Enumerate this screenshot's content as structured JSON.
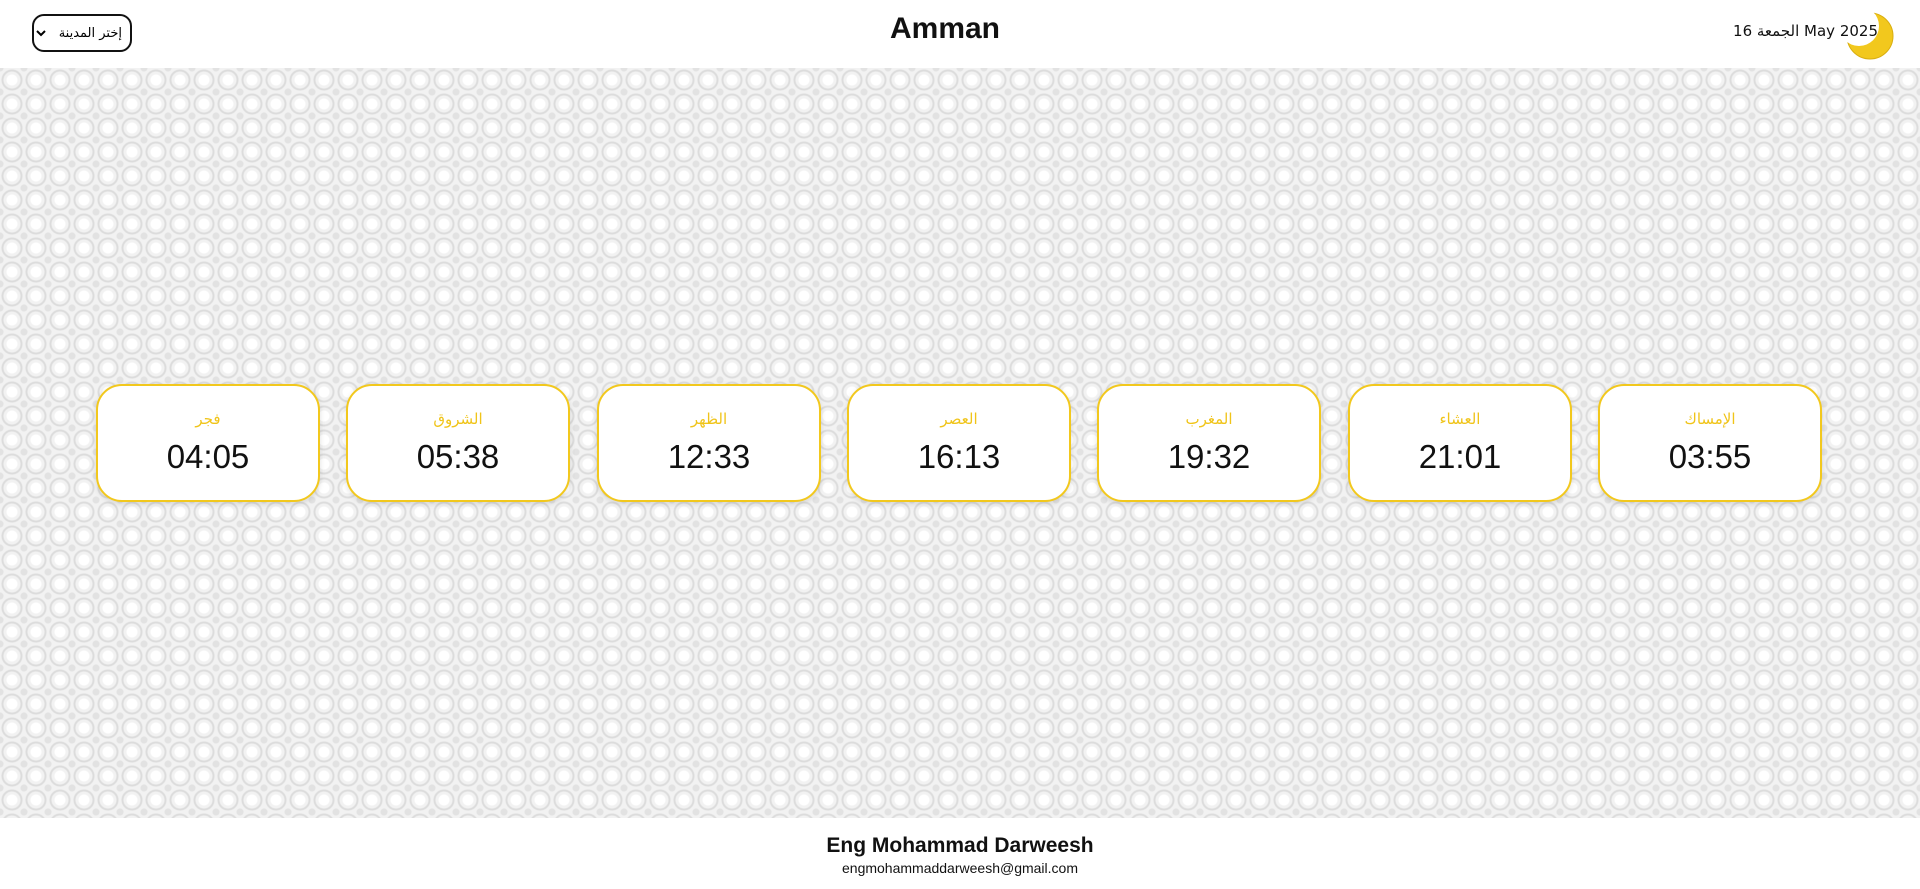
{
  "header": {
    "city_select": {
      "placeholder_option": "إختر المدينة"
    },
    "title": "Amman",
    "date": "الجمعة 16 May 2025",
    "moon_icon": "crescent-moon-icon",
    "moon_color": "#f2c81d"
  },
  "prayers": [
    {
      "name": "فجر",
      "time": "04:05"
    },
    {
      "name": "الشروق",
      "time": "05:38"
    },
    {
      "name": "الظهر",
      "time": "12:33"
    },
    {
      "name": "العصر",
      "time": "16:13"
    },
    {
      "name": "المغرب",
      "time": "19:32"
    },
    {
      "name": "العشاء",
      "time": "21:01"
    },
    {
      "name": "الإمساك",
      "time": "03:55"
    }
  ],
  "footer": {
    "name": "Eng Mohammad Darweesh",
    "email": "engmohammaddarweesh@gmail.com"
  },
  "colors": {
    "accent": "#f2c81d",
    "card_background": "#ffffff",
    "text": "#111111"
  }
}
